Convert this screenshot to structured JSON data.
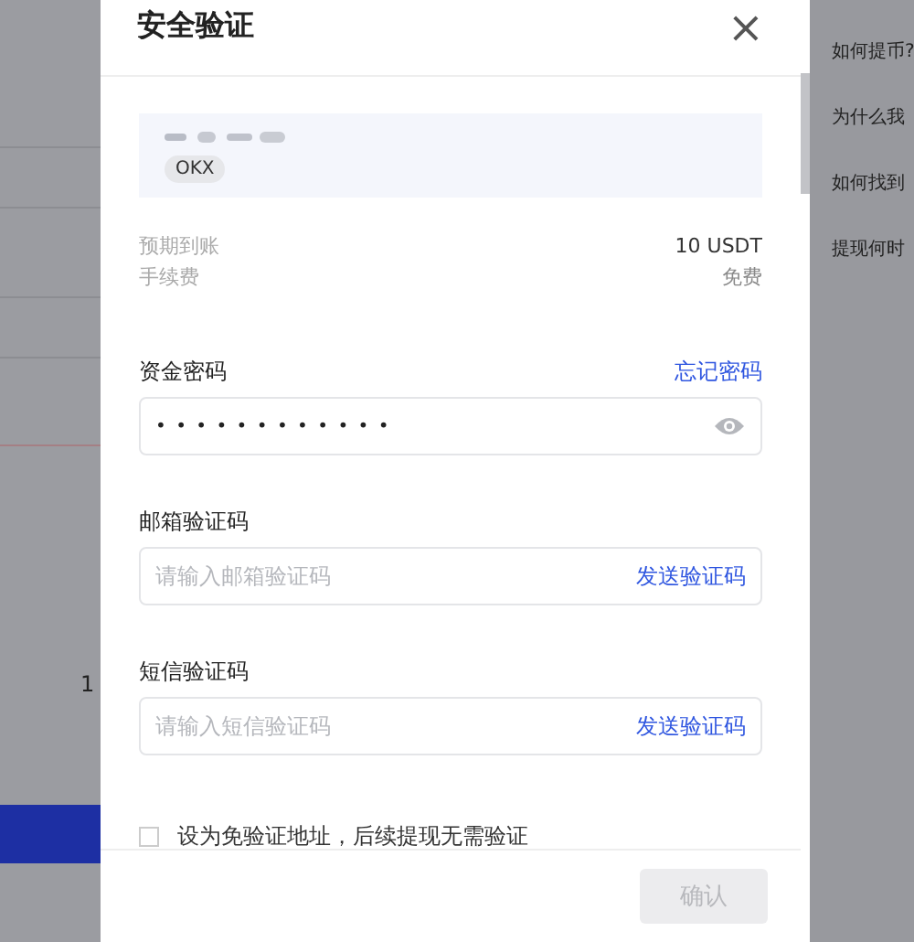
{
  "background": {
    "amount": "1"
  },
  "modal": {
    "title": "安全验证",
    "close": "×",
    "address": {
      "tag": "OKX"
    },
    "summary": [
      {
        "label": "预期到账",
        "value": "10 USDT",
        "emphasis": true
      },
      {
        "label": "手续费",
        "value": "免费",
        "emphasis": false
      }
    ],
    "fields": [
      {
        "label": "资金密码",
        "link": "忘记密码",
        "kind": "password",
        "value": "• • • • • • • • • • • •"
      },
      {
        "label": "邮箱验证码",
        "kind": "code",
        "placeholder": "请输入邮箱验证码",
        "action": "发送验证码"
      },
      {
        "label": "短信验证码",
        "kind": "code",
        "placeholder": "请输入短信验证码",
        "action": "发送验证码"
      }
    ],
    "exempt": {
      "label": "设为免验证地址，后续提现无需验证",
      "checked": false
    },
    "confirm": {
      "label": "确认",
      "disabled": true
    }
  },
  "help": [
    "如何提币?",
    "为什么我",
    "如何找到",
    "提现何时"
  ]
}
